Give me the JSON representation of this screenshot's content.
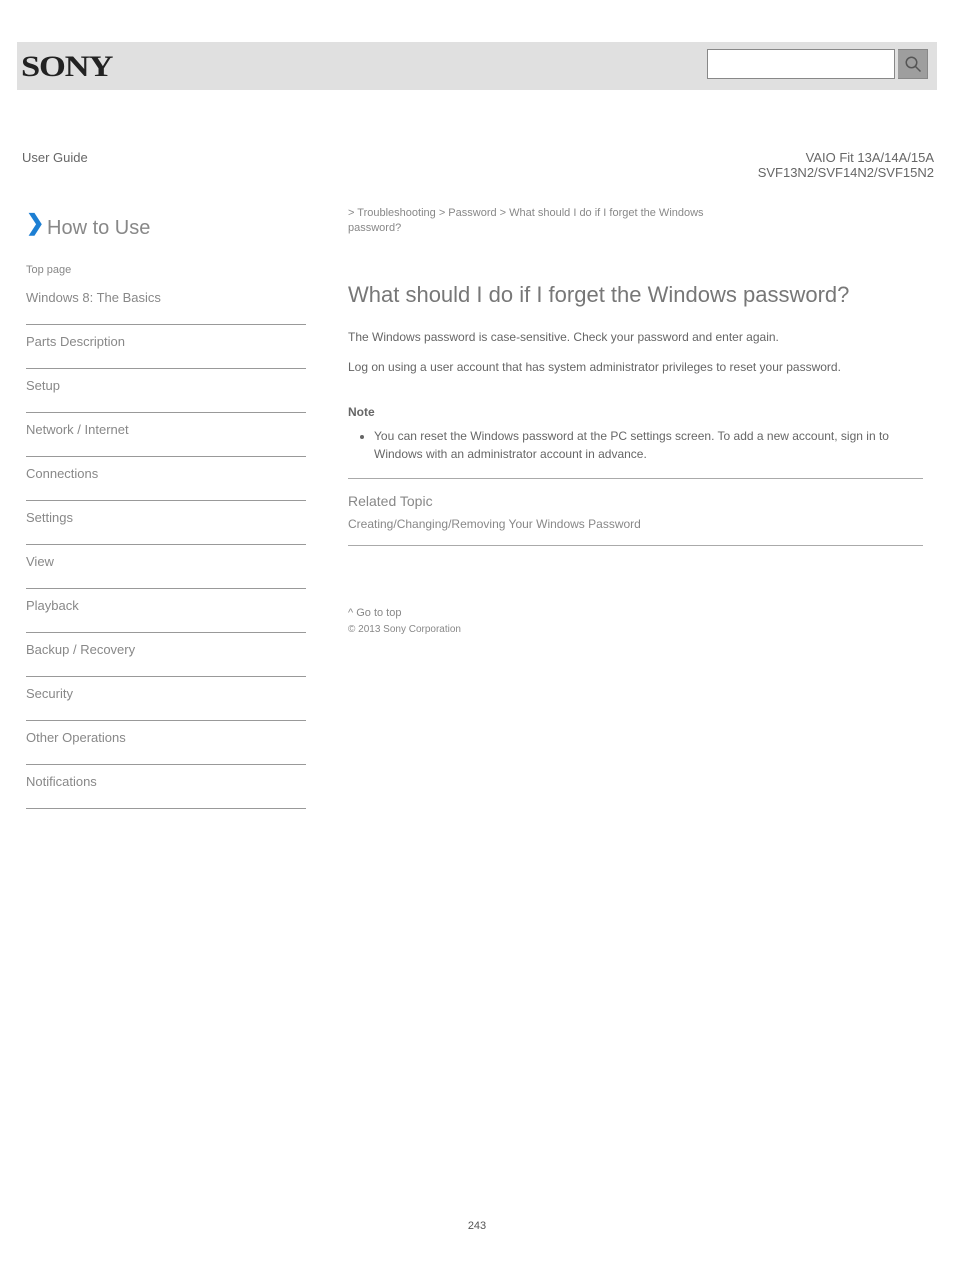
{
  "brand": "SONY",
  "guide_label": "User Guide",
  "series_label": "VAIO Fit 13A/14A/15A\nSVF13N2/SVF14N2/SVF15N2",
  "chev": "❯",
  "howto": "How to Use",
  "toppage": "Top page",
  "breadcrumb": {
    "line1_pre": "> Troubleshooting > ",
    "line1_link": "Password",
    "line1_post": " > What should I do if I forget the Windows",
    "line2": "password?"
  },
  "sidebar": {
    "items": [
      {
        "label": "Windows 8: The Basics",
        "name": "sidebar-item-windows8"
      },
      {
        "label": "Parts Description",
        "name": "sidebar-item-parts"
      },
      {
        "label": "Setup",
        "name": "sidebar-item-setup"
      },
      {
        "label": "Network / Internet",
        "name": "sidebar-item-network"
      },
      {
        "label": "Connections",
        "name": "sidebar-item-connections"
      },
      {
        "label": "Settings",
        "name": "sidebar-item-settings"
      },
      {
        "label": "View",
        "name": "sidebar-item-view"
      },
      {
        "label": "Playback",
        "name": "sidebar-item-playback"
      },
      {
        "label": "Backup / Recovery",
        "name": "sidebar-item-backup"
      },
      {
        "label": "Security",
        "name": "sidebar-item-security"
      },
      {
        "label": "Other Operations",
        "name": "sidebar-item-other"
      },
      {
        "label": "Notifications",
        "name": "sidebar-item-notifications"
      }
    ]
  },
  "main": {
    "title": "What should I do if I forget the Windows password?",
    "p1": "The Windows password is case-sensitive. Check your password and enter again.",
    "p2": "Log on using a user account that has system administrator privileges to reset your password.",
    "note_h": "Note",
    "note1": "You can reset the Windows password at the PC settings screen. To add a new account, sign in to Windows with an administrator account in advance.",
    "related_h": "Related Topic",
    "related_link": "Creating/Changing/Removing Your Windows Password"
  },
  "backtop": "^ Go to top",
  "copyright": "© 2013 Sony Corporation",
  "pagenum": "243",
  "search_placeholder": ""
}
